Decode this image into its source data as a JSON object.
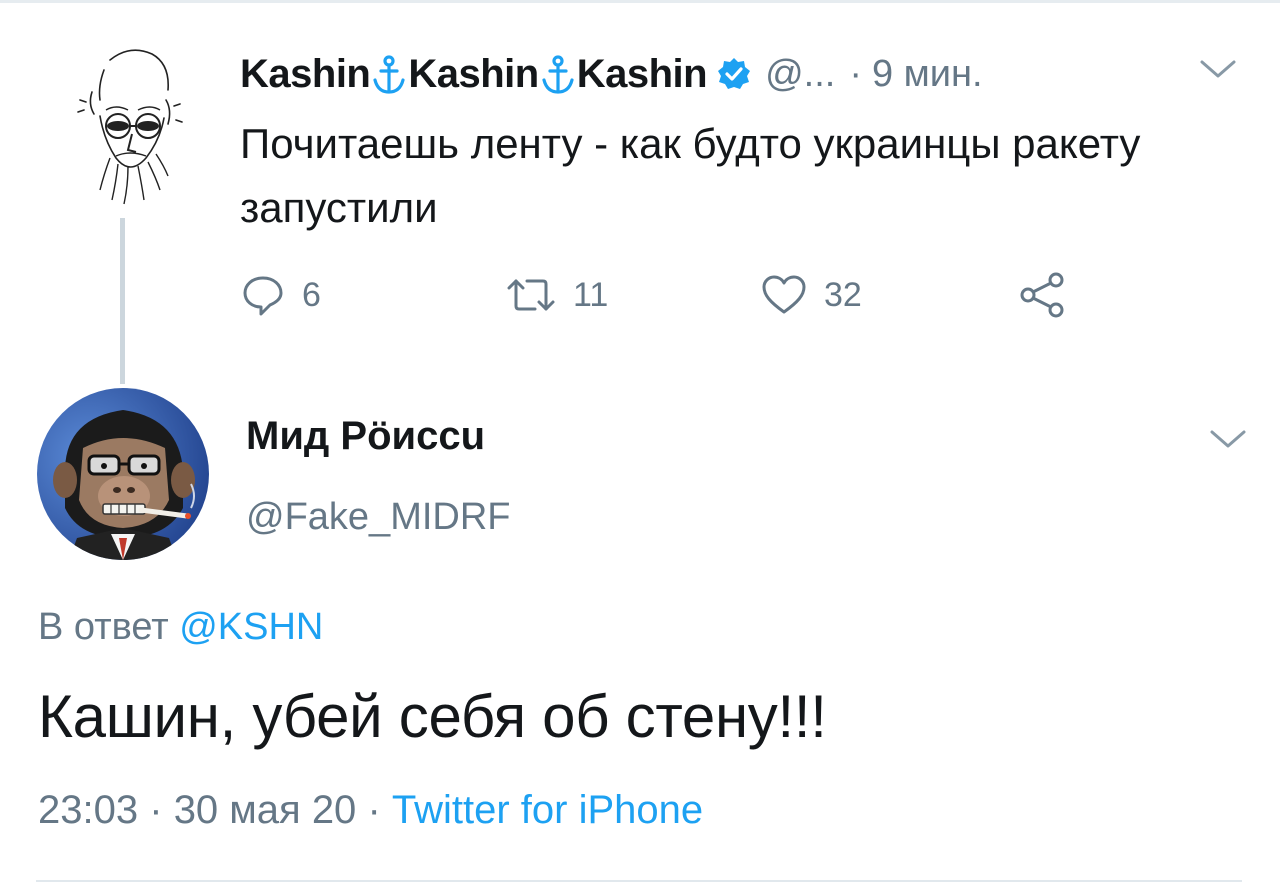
{
  "tweet1": {
    "name_parts": [
      "Kashin",
      "Kashin",
      "Kashin"
    ],
    "separator_icon": "anchor-icon",
    "verified": true,
    "handle": "@...",
    "dot": "·",
    "time": "9 мин.",
    "text": "Почитаешь ленту - как будто украинцы ракету запустили",
    "actions": {
      "replies": "6",
      "retweets": "11",
      "likes": "32"
    }
  },
  "tweet2": {
    "name": "Мид Рöиссu",
    "handle": "@Fake_MIDRF",
    "reply_prefix": "В ответ",
    "reply_mention": "@KSHN",
    "text": "Кашин, убей себя об стену!!!",
    "time": "23:03",
    "sep1": "·",
    "date": "30 мая 20",
    "sep2": "·",
    "source": "Twitter for iPhone"
  },
  "colors": {
    "text": "#14171a",
    "secondary": "#657786",
    "link": "#1da1f2",
    "divider": "#e1e8ed"
  }
}
